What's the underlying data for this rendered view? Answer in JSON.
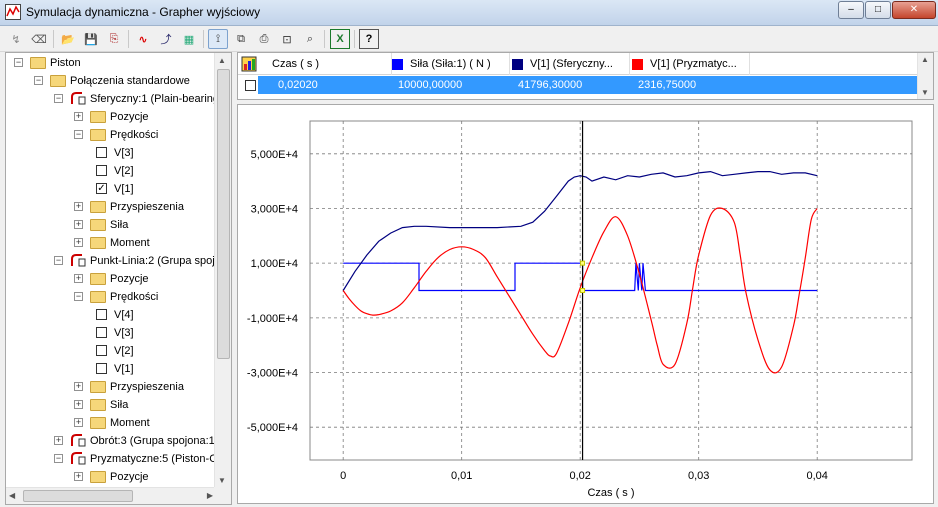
{
  "window": {
    "title": "Symulacja dynamiczna - Grapher wyjściowy",
    "controls": {
      "minimize": "–",
      "maximize": "□",
      "close": "✕"
    }
  },
  "toolbar": {
    "buttons": [
      {
        "name": "tool-a-icon",
        "glyph": "↯"
      },
      {
        "name": "eraser-icon",
        "glyph": "⌫"
      },
      {
        "name": "open-folder-icon",
        "glyph": "📂"
      },
      {
        "name": "save-icon",
        "glyph": "💾"
      },
      {
        "name": "export-icon",
        "glyph": "⎘"
      },
      {
        "name": "curve-icon",
        "glyph": "∿"
      },
      {
        "name": "add-curve-icon",
        "glyph": "⤴"
      },
      {
        "name": "chart-icon",
        "glyph": "▦"
      },
      {
        "name": "cursor-icon",
        "glyph": "⟟"
      },
      {
        "name": "copy-icon",
        "glyph": "⧉"
      },
      {
        "name": "print-icon",
        "glyph": "⎙"
      },
      {
        "name": "zoom-fit-icon",
        "glyph": "⊡"
      },
      {
        "name": "zoom-icon",
        "glyph": "⌕"
      },
      {
        "name": "excel-icon",
        "glyph": "X"
      },
      {
        "name": "help-icon",
        "glyph": "?"
      }
    ]
  },
  "tree": {
    "rows": [
      {
        "text": "Piston",
        "level": 0,
        "kind": "folder",
        "exp": "−"
      },
      {
        "text": "Połączenia standardowe",
        "level": 1,
        "kind": "folder",
        "exp": "−"
      },
      {
        "text": "Sferyczny:1 (Plain-bearing",
        "level": 2,
        "kind": "joint",
        "exp": "−"
      },
      {
        "text": "Pozycje",
        "level": 3,
        "kind": "folder",
        "exp": "+"
      },
      {
        "text": "Prędkości",
        "level": 3,
        "kind": "folder",
        "exp": "−"
      },
      {
        "text": "V[3]",
        "level": 4,
        "kind": "check",
        "checked": ""
      },
      {
        "text": "V[2]",
        "level": 4,
        "kind": "check",
        "checked": ""
      },
      {
        "text": "V[1]",
        "level": 4,
        "kind": "check",
        "checked": "✓"
      },
      {
        "text": "Przyspieszenia",
        "level": 3,
        "kind": "folder",
        "exp": "+"
      },
      {
        "text": "Siła",
        "level": 3,
        "kind": "folder",
        "exp": "+"
      },
      {
        "text": "Moment",
        "level": 3,
        "kind": "folder",
        "exp": "+"
      },
      {
        "text": "Punkt-Linia:2 (Grupa spojo",
        "level": 2,
        "kind": "joint",
        "exp": "−"
      },
      {
        "text": "Pozycje",
        "level": 3,
        "kind": "folder",
        "exp": "+"
      },
      {
        "text": "Prędkości",
        "level": 3,
        "kind": "folder",
        "exp": "−"
      },
      {
        "text": "V[4]",
        "level": 4,
        "kind": "check",
        "checked": ""
      },
      {
        "text": "V[3]",
        "level": 4,
        "kind": "check",
        "checked": ""
      },
      {
        "text": "V[2]",
        "level": 4,
        "kind": "check",
        "checked": ""
      },
      {
        "text": "V[1]",
        "level": 4,
        "kind": "check",
        "checked": ""
      },
      {
        "text": "Przyspieszenia",
        "level": 3,
        "kind": "folder",
        "exp": "+"
      },
      {
        "text": "Siła",
        "level": 3,
        "kind": "folder",
        "exp": "+"
      },
      {
        "text": "Moment",
        "level": 3,
        "kind": "folder",
        "exp": "+"
      },
      {
        "text": "Obrót:3 (Grupa spojona:1",
        "level": 2,
        "kind": "joint",
        "exp": "+"
      },
      {
        "text": "Pryzmatyczne:5 (Piston-C",
        "level": 2,
        "kind": "joint",
        "exp": "−"
      },
      {
        "text": "Pozycje",
        "level": 3,
        "kind": "folder",
        "exp": "+"
      }
    ]
  },
  "table": {
    "columns": [
      {
        "label": "Czas ( s )",
        "color": ""
      },
      {
        "label": "Siła (Siła:1) ( N )",
        "color": "#0000ff"
      },
      {
        "label": "V[1] (Sferyczny...",
        "color": "#000080"
      },
      {
        "label": "V[1] (Pryzmatyc...",
        "color": "#ff0000"
      }
    ],
    "selected_row": [
      "0,02020",
      "10000,00000",
      "41796,30000",
      "2316,75000"
    ]
  },
  "chart_data": {
    "type": "line",
    "xlabel": "Czas ( s )",
    "ylabel": "",
    "xlim": [
      -0.0028,
      0.048
    ],
    "ylim": [
      -6200,
      6200
    ],
    "xticks": [
      {
        "v": 0,
        "label": "0"
      },
      {
        "v": 0.01,
        "label": "0,01"
      },
      {
        "v": 0.02,
        "label": "0,02"
      },
      {
        "v": 0.03,
        "label": "0,03"
      },
      {
        "v": 0.04,
        "label": "0,04"
      }
    ],
    "yticks": [
      {
        "v": 5000,
        "label": "5,000E+4"
      },
      {
        "v": 3000,
        "label": "3,000E+4"
      },
      {
        "v": 1000,
        "label": "1,000E+4"
      },
      {
        "v": -1000,
        "label": "-1,000E+4"
      },
      {
        "v": -3000,
        "label": "-3,000E+4"
      },
      {
        "v": -5000,
        "label": "-5,000E+4"
      }
    ],
    "grid": true,
    "cursor_x": 0.0202,
    "series": [
      {
        "name": "Siła (Siła:1) ( N )",
        "color": "#0000ff",
        "x": [
          0,
          0.0064,
          0.0064,
          0.0145,
          0.0145,
          0.0202,
          0.0202,
          0.0246,
          0.0247,
          0.0249,
          0.025,
          0.0252,
          0.0253,
          0.0255,
          0.0256,
          0.04
        ],
        "y": [
          1000,
          1000,
          0,
          0,
          1000,
          1000,
          0,
          0,
          1000,
          0,
          1000,
          0,
          1000,
          0,
          0,
          0
        ]
      },
      {
        "name": "V[1] (Sferyczny...",
        "color": "#000080",
        "x": [
          0,
          0.001,
          0.002,
          0.003,
          0.004,
          0.005,
          0.006,
          0.007,
          0.009,
          0.011,
          0.013,
          0.015,
          0.016,
          0.017,
          0.018,
          0.019,
          0.0195,
          0.02,
          0.0205,
          0.021,
          0.022,
          0.023,
          0.024,
          0.025,
          0.026,
          0.027,
          0.028,
          0.029,
          0.03,
          0.031,
          0.032,
          0.033,
          0.034,
          0.035,
          0.036,
          0.037,
          0.038,
          0.039,
          0.04
        ],
        "y": [
          0,
          700,
          1300,
          1800,
          2100,
          2300,
          2350,
          2350,
          2300,
          2300,
          2300,
          2350,
          2500,
          2900,
          3450,
          4000,
          4150,
          4200,
          4150,
          4000,
          4150,
          4050,
          4200,
          4150,
          4250,
          4300,
          4150,
          4200,
          4300,
          4350,
          4200,
          4250,
          4300,
          4350,
          4350,
          4250,
          4300,
          4300,
          4200
        ]
      },
      {
        "name": "V[1] (Pryzmatyc...",
        "color": "#ff0000",
        "x": [
          0,
          0.0005,
          0.001,
          0.0015,
          0.002,
          0.0025,
          0.003,
          0.004,
          0.005,
          0.006,
          0.007,
          0.008,
          0.009,
          0.01,
          0.011,
          0.012,
          0.013,
          0.014,
          0.015,
          0.016,
          0.017,
          0.0175,
          0.018,
          0.019,
          0.02,
          0.021,
          0.022,
          0.023,
          0.024,
          0.025,
          0.026,
          0.0265,
          0.027,
          0.028,
          0.029,
          0.0295,
          0.03,
          0.031,
          0.032,
          0.033,
          0.0335,
          0.034,
          0.035,
          0.036,
          0.037,
          0.038,
          0.0385,
          0.039,
          0.0395,
          0.04
        ],
        "y": [
          0,
          -300,
          -550,
          -750,
          -850,
          -900,
          -880,
          -750,
          -450,
          100,
          700,
          1200,
          1500,
          1600,
          1500,
          1200,
          500,
          -200,
          -900,
          -1600,
          -2200,
          -2400,
          -2300,
          -1200,
          100,
          1200,
          2150,
          2700,
          2000,
          600,
          -1100,
          -2000,
          -2700,
          -2700,
          -1200,
          100,
          1300,
          2750,
          3000,
          2500,
          1300,
          -100,
          -1800,
          -2900,
          -2800,
          -1300,
          -100,
          1200,
          2600,
          3000
        ]
      }
    ]
  }
}
